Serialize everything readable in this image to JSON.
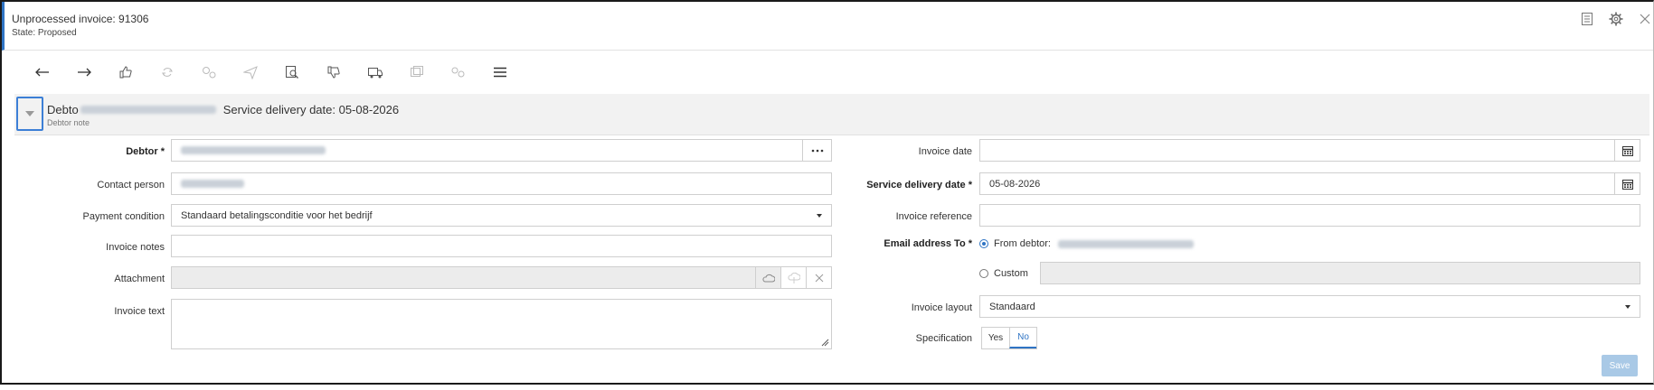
{
  "window": {
    "title": "Unprocessed invoice: 91306",
    "state": "State: Proposed"
  },
  "titlebar_icons": [
    "document-icon",
    "gear-icon",
    "close-icon"
  ],
  "toolbar": [
    "arrow-left-icon",
    "arrow-right-icon",
    "thumbs-up-icon",
    "refresh-icon",
    "gears-icon",
    "send-icon",
    "preview-icon",
    "thumbs-down-icon",
    "truck-icon",
    "copy-icon",
    "link-icon",
    "menu-icon"
  ],
  "band": {
    "title_prefix": "Debto",
    "service_label": "Service delivery date: 05-08-2026",
    "note": "Debtor note"
  },
  "left_form": {
    "debtor_label": "Debtor *",
    "contact_label": "Contact person",
    "payment_label": "Payment condition",
    "payment_value": "Standaard betalingsconditie voor het bedrijf",
    "notes_label": "Invoice notes",
    "attachment_label": "Attachment",
    "text_label": "Invoice text"
  },
  "right_form": {
    "invoice_date_label": "Invoice date",
    "service_date_label": "Service delivery date *",
    "service_date_value": "05-08-2026",
    "reference_label": "Invoice reference",
    "email_label": "Email address To *",
    "from_debtor_label": "From debtor:",
    "custom_label": "Custom",
    "layout_label": "Invoice layout",
    "layout_value": "Standaard",
    "specification_label": "Specification",
    "yes_label": "Yes",
    "no_label": "No"
  },
  "save_label": "Save",
  "colors": {
    "accent": "#2f74c4",
    "save_disabled": "#a9c9e6"
  }
}
